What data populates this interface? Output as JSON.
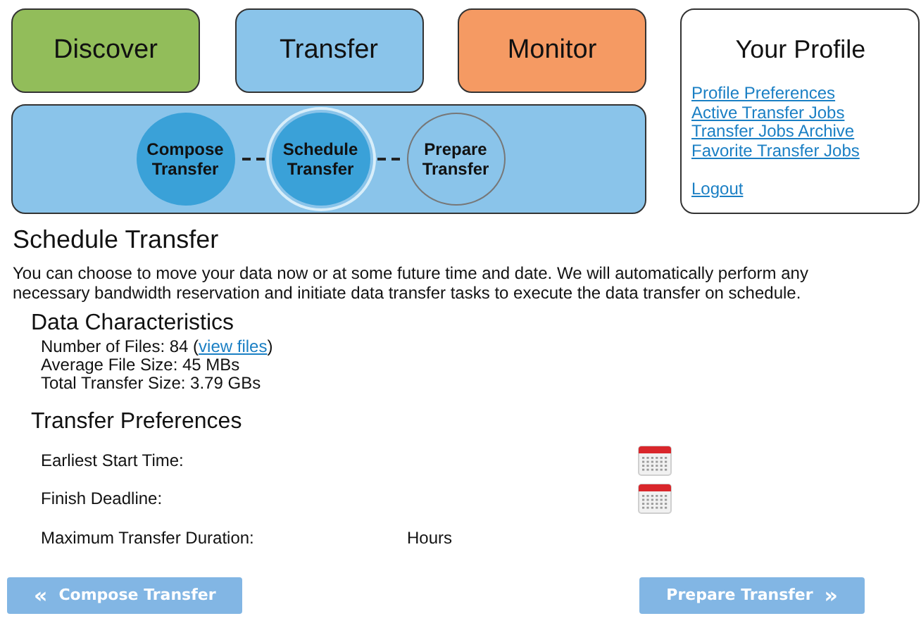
{
  "nav_tabs": [
    {
      "label": "Discover",
      "color": "#92bd5a"
    },
    {
      "label": "Transfer",
      "color": "#8ac4ea"
    },
    {
      "label": "Monitor",
      "color": "#f59a63"
    }
  ],
  "steps": [
    {
      "label": "Compose Transfer",
      "kind": "done"
    },
    {
      "label": "Schedule Transfer",
      "kind": "current"
    },
    {
      "label": "Prepare Transfer",
      "kind": "upcoming"
    }
  ],
  "profile": {
    "title": "Your Profile",
    "links": [
      "Profile Preferences",
      "Active Transfer Jobs",
      "Transfer Jobs Archive",
      "Favorite Transfer Jobs"
    ],
    "logout": "Logout"
  },
  "page_title": "Schedule Transfer",
  "intro": "You can choose to move your data now or at some future time and date. We will automatically perform any necessary bandwidth reservation and initiate data transfer tasks to execute the data transfer on schedule.",
  "data_characteristics": {
    "title": "Data Characteristics",
    "files_label": "Number of Files: 84 (",
    "files_link": "view files",
    "files_close": ")",
    "lines": [
      "Average File Size: 45 MBs",
      "Total Transfer Size: 3.79 GBs"
    ]
  },
  "preferences": {
    "title": "Transfer Preferences",
    "rows": [
      {
        "kind": "date",
        "label": "Earliest Start Time:"
      },
      {
        "kind": "date",
        "label": "Finish Deadline:"
      },
      {
        "kind": "duration",
        "label": "Maximum Transfer Duration:",
        "unit": "Hours"
      }
    ]
  },
  "buttons": {
    "back": {
      "icon": "«",
      "label": "Compose Transfer"
    },
    "next": {
      "label": "Prepare Transfer",
      "icon": "»"
    }
  }
}
